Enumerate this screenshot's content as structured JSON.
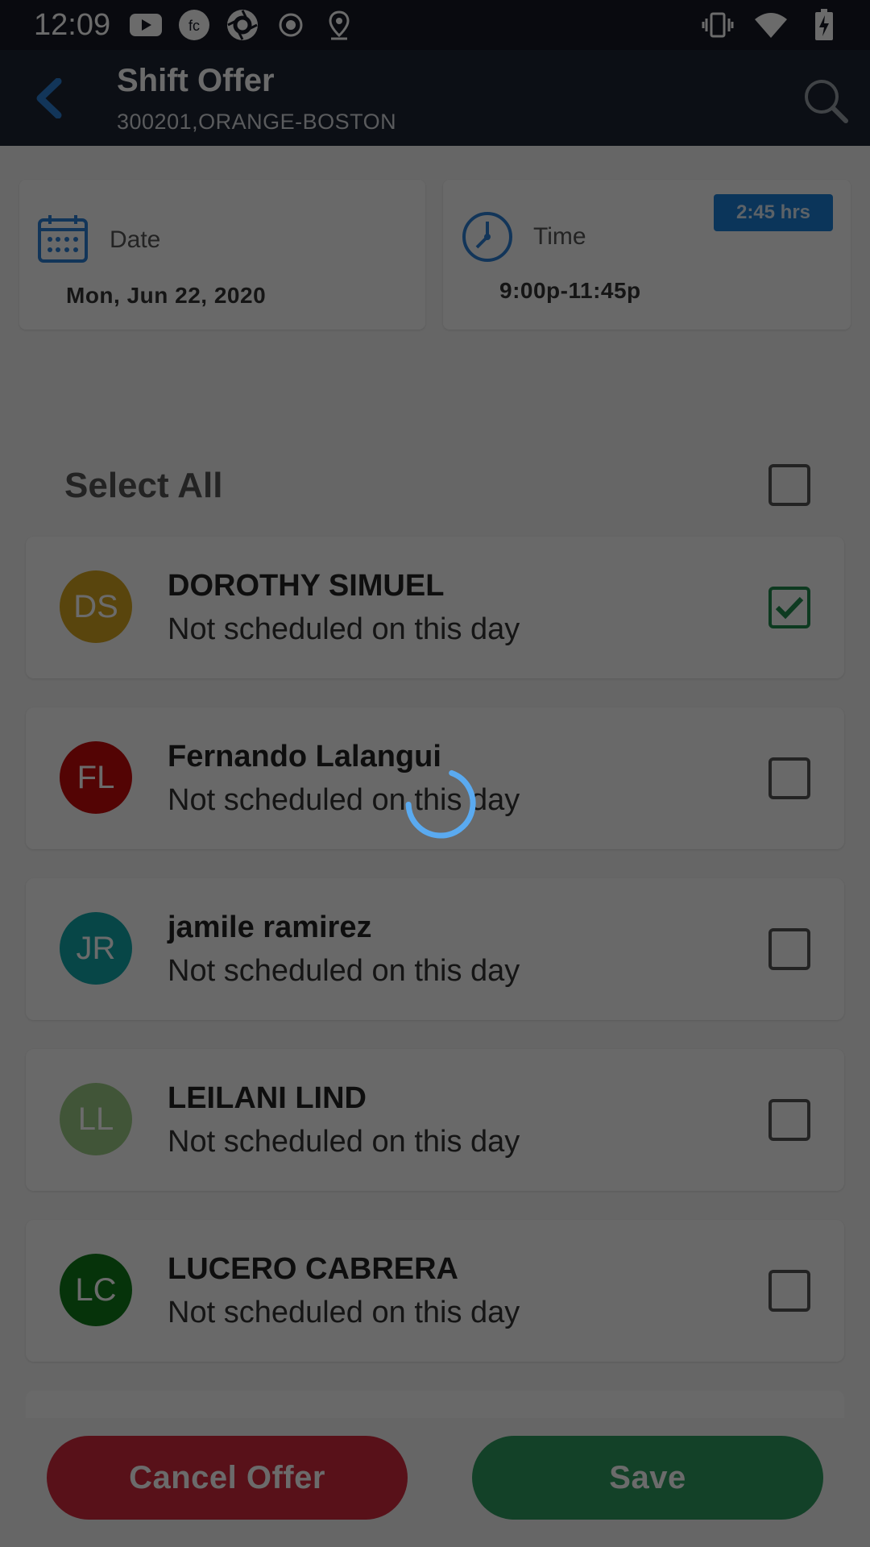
{
  "status_bar": {
    "time": "12:09",
    "left_icons": [
      "youtube-icon",
      "fc-app-icon",
      "shutter-app-icon",
      "record-icon",
      "location-pin-icon"
    ],
    "right_icons": [
      "vibrate-icon",
      "wifi-icon",
      "battery-charging-icon"
    ]
  },
  "app_bar": {
    "title": "Shift Offer",
    "subtitle": "300201,ORANGE-BOSTON"
  },
  "date_card": {
    "label": "Date",
    "value": "Mon, Jun 22, 2020"
  },
  "time_card": {
    "label": "Time",
    "value": "9:00p-11:45p",
    "badge": "2:45 hrs"
  },
  "select_all": {
    "label": "Select All",
    "checked": false
  },
  "employees": [
    {
      "initials": "DS",
      "name": "DOROTHY SIMUEL",
      "status": "Not scheduled on this day",
      "checked": true,
      "color": "#d4a520"
    },
    {
      "initials": "FL",
      "name": "Fernando Lalangui",
      "status": "Not scheduled on this day",
      "checked": false,
      "color": "#c50a0a"
    },
    {
      "initials": "JR",
      "name": "jamile ramirez",
      "status": "Not scheduled on this day",
      "checked": false,
      "color": "#12a8aa"
    },
    {
      "initials": "LL",
      "name": "LEILANI LIND",
      "status": "Not scheduled on this day",
      "checked": false,
      "color": "#9ccb85"
    },
    {
      "initials": "LC",
      "name": "LUCERO CABRERA",
      "status": "Not scheduled on this day",
      "checked": false,
      "color": "#0f7a1a"
    }
  ],
  "buttons": {
    "cancel": "Cancel Offer",
    "save": "Save"
  },
  "colors": {
    "accent": "#2b7fd4",
    "cancel": "#d22a3c",
    "save": "#2f9b60",
    "loading_spinner": "#5aaaf0"
  }
}
